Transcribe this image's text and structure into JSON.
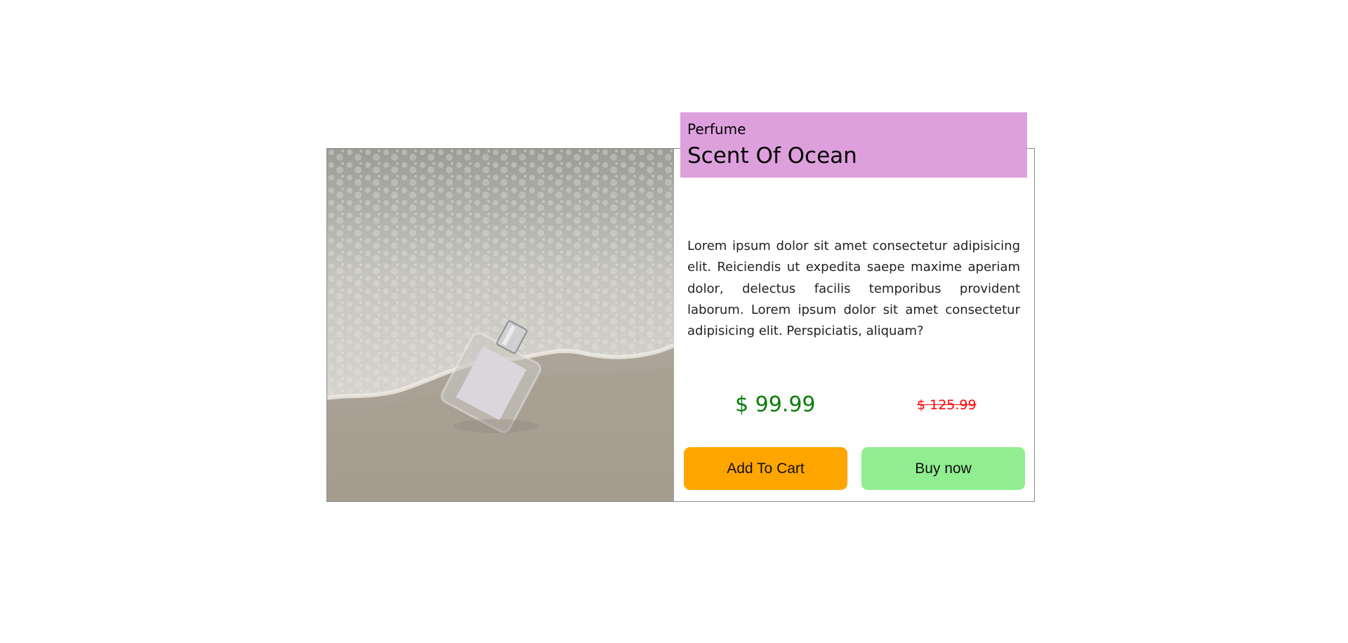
{
  "product": {
    "category": "Perfume",
    "title": "Scent Of Ocean",
    "description": "Lorem ipsum dolor sit amet consectetur adipisicing elit. Reiciendis ut expedita saepe maxime aperiam dolor, delectus facilis temporibus provident laborum. Lorem ipsum dolor sit amet consectetur adipisicing elit. Perspiciatis, aliquam?",
    "price": "$ 99.99",
    "original_price": "$ 125.99"
  },
  "actions": {
    "add_to_cart_label": "Add To Cart",
    "buy_now_label": "Buy now"
  },
  "colors": {
    "header_bg": "#dda0dd",
    "price_color": "#008000",
    "old_price_color": "#ff0000",
    "cart_button": "#ffa500",
    "buy_button": "#90ee90"
  }
}
